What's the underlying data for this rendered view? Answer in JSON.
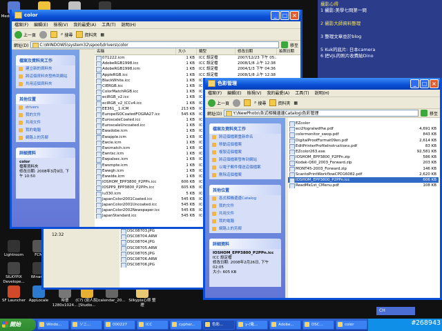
{
  "taskbar": {
    "start_label": "開始",
    "buttons": [
      "Windo...",
      "ソニ...",
      "000227",
      "ICC",
      "cypher...",
      "色彩...",
      "y-(電...",
      "Adobe...",
      "DSC...",
      "color"
    ],
    "tray_label": "CH",
    "watermark": "#268943"
  },
  "desktop_icons": [
    {
      "label": "Media Center"
    },
    {
      "label": "Light"
    },
    {
      "label": "Wi"
    },
    {
      "label": "Winamp"
    },
    {
      "label": "Lightroom"
    },
    {
      "label": "FCM"
    },
    {
      "label": "SILKYPIX Develope..."
    },
    {
      "label": "Winamp"
    },
    {
      "label": "時晉 1024x768.jpg"
    },
    {
      "label": "SF Launcher"
    },
    {
      "label": "AppLocale"
    },
    {
      "label": "時晉 1280x1024..."
    },
    {
      "label": "(C?) (別人說) [Studio..."
    },
    {
      "label": "calendar_20..."
    },
    {
      "label": "Silkypix心得 整理"
    }
  ],
  "news_panel": {
    "lines": [
      "攝影心得",
      "1 攝影:美學七問第一問",
      "2 攝影大師資料整理",
      "3 整理文章並於blog",
      "5 Kuk的底片: 日本camera",
      "6 把VJL的照片收費給Dino"
    ]
  },
  "win_color": {
    "title": "color",
    "menu": [
      "檔案(F)",
      "編輯(E)",
      "檢視(V)",
      "我的最愛(A)",
      "工具(T)",
      "說明(H)"
    ],
    "back": "上一頁",
    "search": "搜尋",
    "folders": "資料夾",
    "address_label": "網址(D)",
    "address": "C:\\WINDOWS\\system32\\spool\\drivers\\color",
    "go": "移至",
    "tasks_title": "檔案及資料夾工作",
    "tasks": [
      "建立新的資料夾",
      "將這個資料夾發佈到網站",
      "共用這個資料夾"
    ],
    "places_title": "其他位置",
    "places": [
      "drivers",
      "我的文件",
      "共用文件",
      "我的電腦",
      "網路上的芳鄰"
    ],
    "details_title": "詳細資料",
    "details_name": "color",
    "details_type": "檔案資料夾",
    "details_modified": "修改日期: 2008年3月9日, 下午 10:50",
    "headers": [
      "名稱",
      "大小",
      "類型",
      "修改日期",
      "拍照日期"
    ],
    "files": [
      {
        "name": "071222.icm",
        "size": "1 KB",
        "type": "ICC 設定檔",
        "date": "2007/12/23 下午 05:..."
      },
      {
        "name": "AdobeRGB1998.icc",
        "size": "1 KB",
        "type": "ICC 設定檔",
        "date": "2008/1/8 上午 12:38"
      },
      {
        "name": "AdobeRGB1998.icm",
        "size": "1 KB",
        "type": "ICC 設定檔",
        "date": "2004/1/3 下午 04:36"
      },
      {
        "name": "AppleRGB.icc",
        "size": "1 KB",
        "type": "ICC 設定檔",
        "date": "2008/1/8 上午 12:38"
      },
      {
        "name": "BlackWhite.icc",
        "size": "1 KB",
        "type": "ICC 設定檔",
        "date": ""
      },
      {
        "name": "CIERGB.icc",
        "size": "1 KB",
        "type": "ICC 設定檔",
        "date": ""
      },
      {
        "name": "ColorMatchRGB.icc",
        "size": "1 KB",
        "type": "ICC 設定檔",
        "date": ""
      },
      {
        "name": "eciRGB_v2.icc",
        "size": "1 KB",
        "type": "ICC 設定檔",
        "date": ""
      },
      {
        "name": "eciRGB_v2_ICCv4.icc",
        "size": "1 KB",
        "type": "ICC 設定檔",
        "date": ""
      },
      {
        "name": "EE361__1.ICM",
        "size": "213 KB",
        "type": "ICC 設定檔",
        "date": ""
      },
      {
        "name": "EuropeISOCoatedFOGRA27.icc",
        "size": "545 KB",
        "type": "ICC 設定檔",
        "date": ""
      },
      {
        "name": "EuroscaleCoated.icc",
        "size": "1 KB",
        "type": "ICC 設定檔",
        "date": ""
      },
      {
        "name": "EuroscaleUncoated.icc",
        "size": "1 KB",
        "type": "ICC 設定檔",
        "date": ""
      },
      {
        "name": "Ewadobe.icm",
        "size": "1 KB",
        "type": "ICC 設定檔",
        "date": ""
      },
      {
        "name": "Ewapple.icm",
        "size": "1 KB",
        "type": "ICC 設定檔",
        "date": ""
      },
      {
        "name": "Ewcie.icm",
        "size": "1 KB",
        "type": "ICC 設定檔",
        "date": ""
      },
      {
        "name": "Ewcmatch.icm",
        "size": "1 KB",
        "type": "ICC 設定檔",
        "date": ""
      },
      {
        "name": "Ewntsc.icm",
        "size": "1 KB",
        "type": "ICC 設定檔",
        "date": ""
      },
      {
        "name": "Ewpalsec.icm",
        "size": "1 KB",
        "type": "ICC 設定檔",
        "date": ""
      },
      {
        "name": "Ewsmpte.icm",
        "size": "1 KB",
        "type": "ICC 設定檔",
        "date": ""
      },
      {
        "name": "Ewwgh.icm",
        "size": "1 KB",
        "type": "ICC 設定檔",
        "date": ""
      },
      {
        "name": "Ewwide.icm",
        "size": "1 KB",
        "type": "ICC 設定檔",
        "date": ""
      },
      {
        "name": "IOSHOM_EPP3800_P2PPn.icc",
        "size": "606 KB",
        "type": "ICC 設定檔",
        "date": ""
      },
      {
        "name": "IOSPP9_EPP3800_P2PPn.icc",
        "size": "605 KB",
        "type": "ICC 設定檔",
        "date": ""
      },
      {
        "name": "iu330.icm",
        "size": "5 KB",
        "type": "ICC 設定檔",
        "date": ""
      },
      {
        "name": "JapanColor2001Coated.icc",
        "size": "545 KB",
        "type": "ICC 設定檔",
        "date": ""
      },
      {
        "name": "JapanColor2001Uncoated.icc",
        "size": "545 KB",
        "type": "ICC 設定檔",
        "date": ""
      },
      {
        "name": "JapanColor2002Newspaper.icc",
        "size": "545 KB",
        "type": "ICC 設定檔",
        "date": ""
      },
      {
        "name": "JapanStandard.icc",
        "size": "545 KB",
        "type": "ICC 設定檔",
        "date": ""
      }
    ]
  },
  "win_mgmt": {
    "title": "色彩管理",
    "menu": [
      "檔案(F)",
      "編輯(E)",
      "檢視(V)",
      "我的最愛(A)",
      "工具(T)",
      "說明(H)"
    ],
    "back": "上一頁",
    "search": "搜尋",
    "folders": "資料夾",
    "address_label": "網址(D)",
    "address": "Y:\\NewPhoto\\各式相機邊邊Catalog\\色彩管理",
    "go": "移至",
    "tasks_title": "檔案及資料夾工作",
    "tasks": [
      "將這個檔案重新命名",
      "移動這個檔案",
      "複製這個檔案",
      "將這個檔案發佈到網站",
      "以電子郵件傳送這個檔案",
      "刪除這個檔案"
    ],
    "places_title": "其他位置",
    "places": [
      "各式相機邊邊Catalog",
      "我的文件",
      "共用文件",
      "我的電腦",
      "網路上的芳鄰"
    ],
    "details_title": "詳細資料",
    "details_name": "IOSHOM_EPP3800_P2PPn.icc",
    "details_type": "ICC 設定檔",
    "details_modified": "修改日期: 2008年2月26日, 下午 02:05",
    "details_size": "大小: 605 KB",
    "files": [
      {
        "name": "EZcolor",
        "size": ""
      },
      {
        "name": "eci2fogralwdfhe.pdf",
        "size": "4,691 KB"
      },
      {
        "name": "colormonitor_swop.pdf",
        "size": "843 KB"
      },
      {
        "name": "DigitalProofFormat09en.pdf",
        "size": "2,614 KB"
      },
      {
        "name": "EditPrinterProfileInstructions.pdf",
        "size": "83 KB"
      },
      {
        "name": "EZcolor263.exe",
        "size": "92,581 KB"
      },
      {
        "name": "IOSHOM_EPP3800_P2PPn.zip",
        "size": "586 KB"
      },
      {
        "name": "Kodak-Q60_2003_Forward.zip",
        "size": "203 KB"
      },
      {
        "name": "MONT45-2003_Forward.zip",
        "size": "146 KB"
      },
      {
        "name": "ScantoPrintWorkflowCPD16082.pdf",
        "size": "2,620 KB"
      },
      {
        "name": "IOSHOM_EPP3800_P2PPn.icc",
        "size": "606 KB"
      },
      {
        "name": "ReadMe1st_CMenu.pdf",
        "size": "108 KB"
      }
    ],
    "selected_index": 10
  },
  "bg_list": {
    "files": [
      "DSC08703.JPG",
      "DSC08704.ARW",
      "DSC08704.JPG",
      "DSC08705.ARW",
      "DSC08705.JPG",
      "DSC08706.ARW",
      "DSC08706.JPG"
    ],
    "sizes": [
      "2,4",
      "2,0",
      "2,5",
      "2,0",
      "2,4",
      "2,0",
      "2,4"
    ],
    "time": "12:32"
  }
}
